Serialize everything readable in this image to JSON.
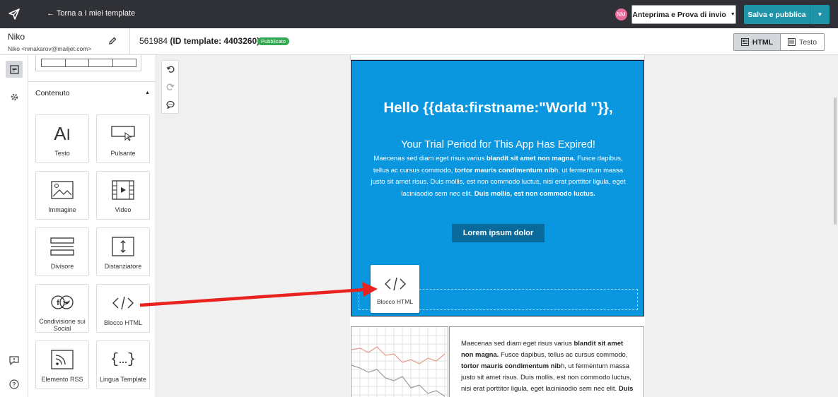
{
  "topbar": {
    "back_label": "← Torna a I miei template",
    "avatar_initials": "NM",
    "preview_label": "Anteprima e Prova di invio",
    "save_label": "Salva e pubblica"
  },
  "user": {
    "name": "Niko",
    "email": "Niko <nmakarov@mailjet.com>"
  },
  "template": {
    "id_number": "561984",
    "id_label": "(ID template: 4403260)",
    "status": "Pubblicato"
  },
  "view_tabs": {
    "html": "HTML",
    "text": "Testo"
  },
  "panel": {
    "section_title": "Contenuto",
    "tiles": [
      {
        "label": "Testo",
        "icon": "text-icon"
      },
      {
        "label": "Pulsante",
        "icon": "button-icon"
      },
      {
        "label": "Immagine",
        "icon": "image-icon"
      },
      {
        "label": "Video",
        "icon": "video-icon"
      },
      {
        "label": "Divisore",
        "icon": "divider-icon"
      },
      {
        "label": "Distanziatore",
        "icon": "spacer-icon"
      },
      {
        "label": "Condivisione sui Social",
        "icon": "social-share-icon"
      },
      {
        "label": "Blocco HTML",
        "icon": "html-block-icon"
      },
      {
        "label": "Elemento RSS",
        "icon": "rss-icon"
      },
      {
        "label": "Lingua Template",
        "icon": "template-language-icon"
      }
    ]
  },
  "email": {
    "hero_title": "Hello {{data:firstname:\"World \"}},",
    "hero_subtitle": "Your Trial Period for This App Has Expired!",
    "hero_body_1": "Maecenas sed diam eget risus varius ",
    "hero_body_b1": "blandit sit amet non magna.",
    "hero_body_2": " Fusce dapibus, tellus ac cursus commodo, ",
    "hero_body_b2": "tortor mauris condimentum nib",
    "hero_body_3": "h, ut fermentum massa justo sit amet risus. Duis mollis, est non commodo luctus, nisi erat porttitor ligula, eget laciniaodio sem nec elit. ",
    "hero_body_b3": "Duis mollis, est non commodo luctus.",
    "hero_button": "Lorem ipsum dolor",
    "dragged_block_label": "Blocco HTML",
    "col_text_1": "Maecenas sed diam eget risus varius ",
    "col_text_b1": "blandit sit amet non magna.",
    "col_text_2": " Fusce dapibus, tellus ac cursus commodo, ",
    "col_text_b2": "tortor mauris condimentum nib",
    "col_text_3": "h, ut fermentum massa justo sit amet risus. Duis mollis, est non commodo luctus, nisi erat porttitor ligula, eget laciniaodio sem nec elit. ",
    "col_text_b3": "Duis mollis, est non commodo luctus."
  },
  "colors": {
    "topbar": "#2f3137",
    "accent": "#1f94a8",
    "hero_bg": "#0a97e0",
    "published": "#35a853",
    "annotation_arrow": "#e8231f"
  }
}
